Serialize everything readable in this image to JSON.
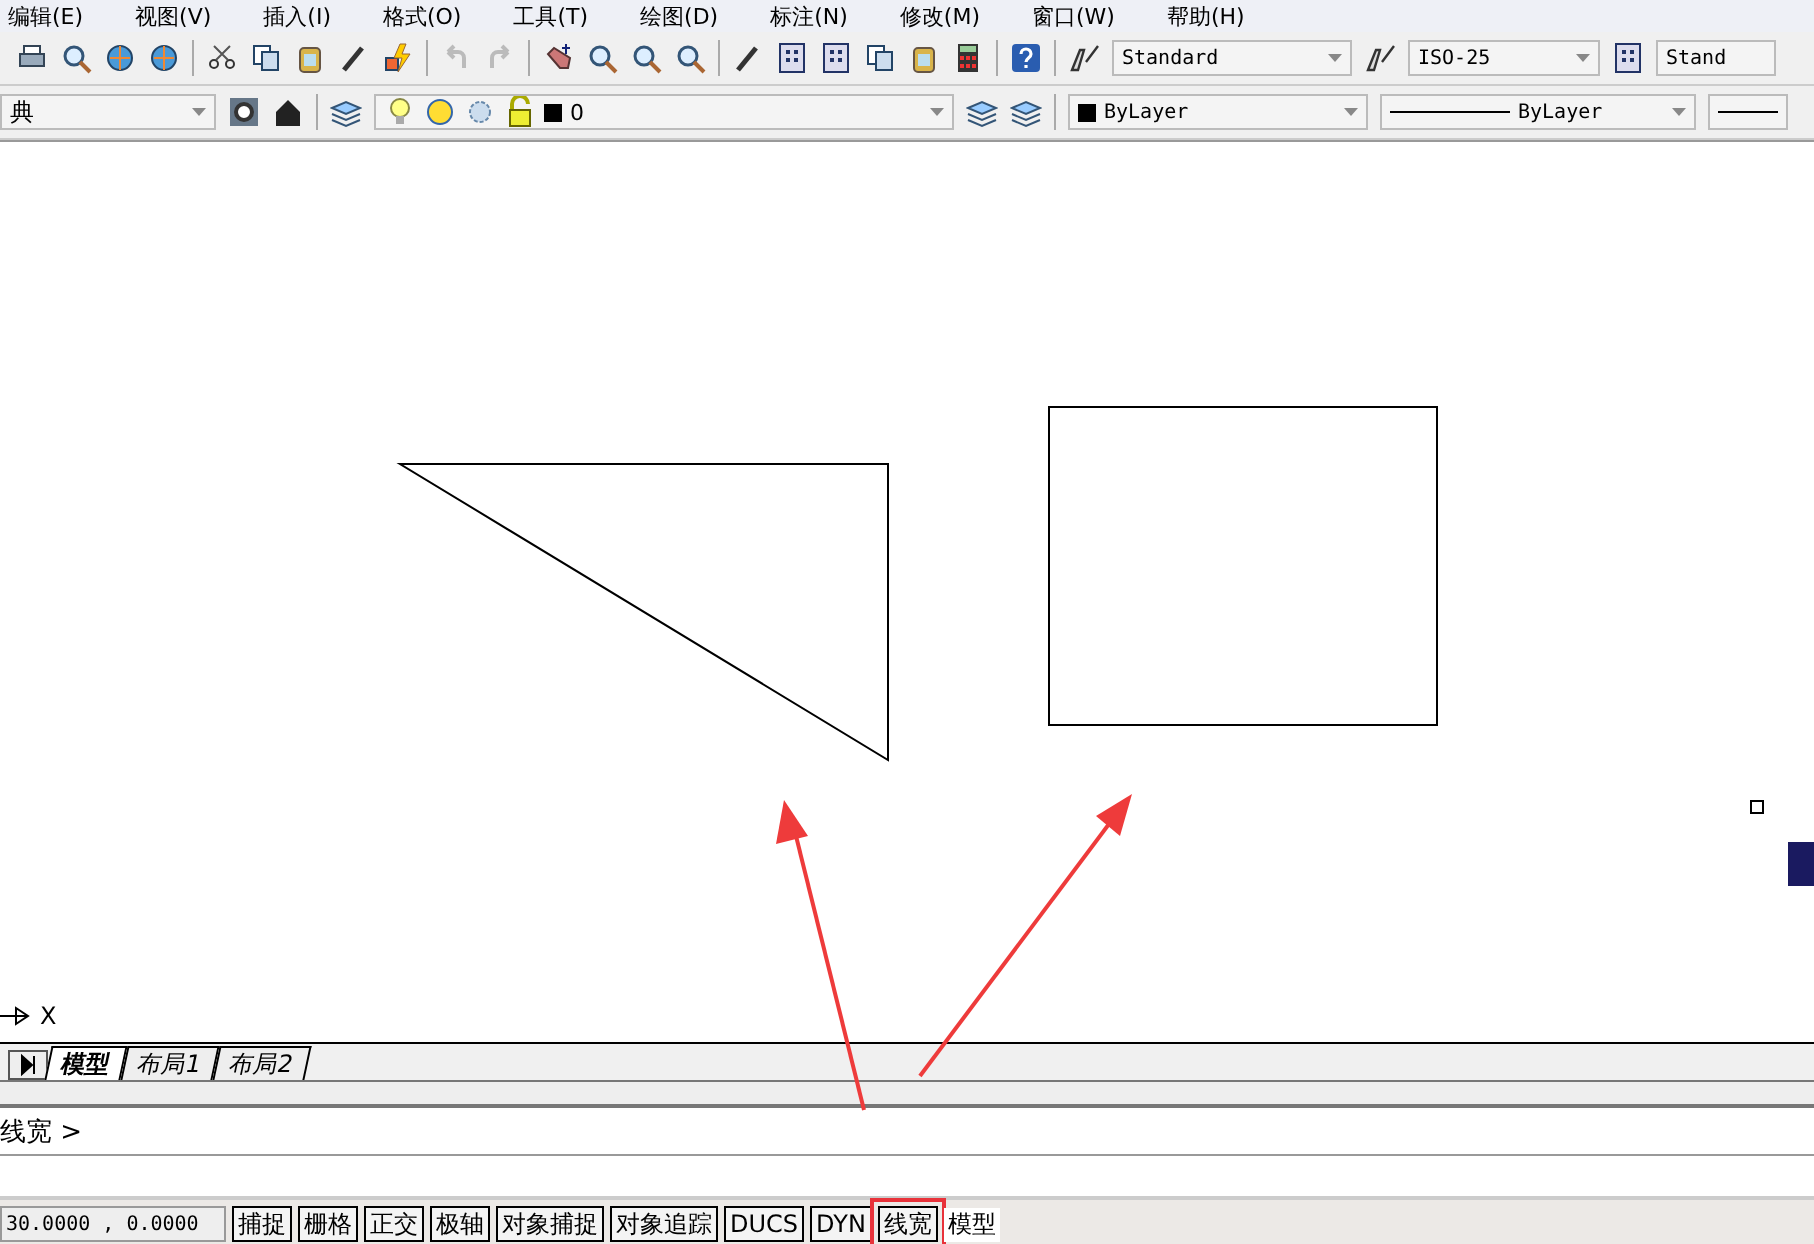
{
  "menu": [
    "编辑(E)",
    "视图(V)",
    "插入(I)",
    "格式(O)",
    "工具(T)",
    "绘图(D)",
    "标注(N)",
    "修改(M)",
    "窗口(W)",
    "帮助(H)"
  ],
  "styles_toolbar": {
    "text_style": "Standard",
    "dim_style": "ISO-25",
    "table_style": "Stand"
  },
  "workspace": {
    "value": "典"
  },
  "layer": {
    "name": "0"
  },
  "properties": {
    "color_setting": "ByLayer",
    "linetype": "ByLayer"
  },
  "canvas": {
    "ucs_label": "X"
  },
  "layout_tabs": [
    {
      "label": "模型",
      "selected": true
    },
    {
      "label": "布局1",
      "selected": false
    },
    {
      "label": "布局2",
      "selected": false
    }
  ],
  "command_line": {
    "text": "线宽 >"
  },
  "status_bar": {
    "coordinates": "30.0000 , 0.0000",
    "buttons": [
      {
        "label": "捕捉",
        "annotated": false
      },
      {
        "label": "栅格",
        "annotated": false
      },
      {
        "label": "正交",
        "annotated": false
      },
      {
        "label": "极轴",
        "annotated": false
      },
      {
        "label": "对象捕捉",
        "annotated": false
      },
      {
        "label": "对象追踪",
        "annotated": false
      },
      {
        "label": "DUCS",
        "annotated": false
      },
      {
        "label": "DYN",
        "annotated": false
      },
      {
        "label": "线宽",
        "annotated": true
      }
    ],
    "space": "模型"
  }
}
